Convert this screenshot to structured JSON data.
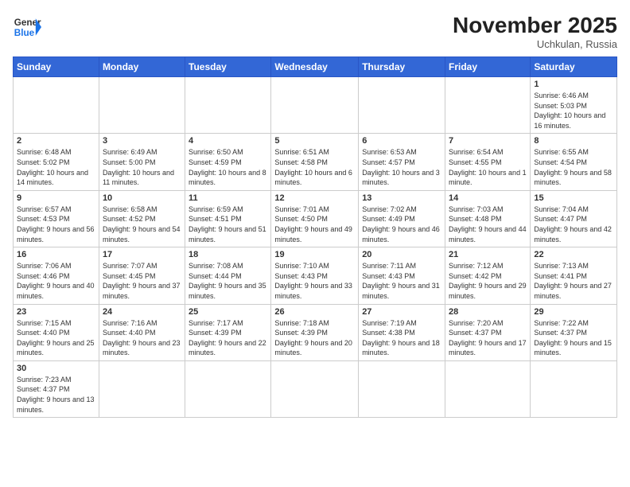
{
  "header": {
    "logo_general": "General",
    "logo_blue": "Blue",
    "month": "November 2025",
    "location": "Uchkulan, Russia"
  },
  "days": [
    "Sunday",
    "Monday",
    "Tuesday",
    "Wednesday",
    "Thursday",
    "Friday",
    "Saturday"
  ],
  "weeks": [
    [
      {
        "date": "",
        "info": ""
      },
      {
        "date": "",
        "info": ""
      },
      {
        "date": "",
        "info": ""
      },
      {
        "date": "",
        "info": ""
      },
      {
        "date": "",
        "info": ""
      },
      {
        "date": "",
        "info": ""
      },
      {
        "date": "1",
        "info": "Sunrise: 6:46 AM\nSunset: 5:03 PM\nDaylight: 10 hours and 16 minutes."
      }
    ],
    [
      {
        "date": "2",
        "info": "Sunrise: 6:48 AM\nSunset: 5:02 PM\nDaylight: 10 hours and 14 minutes."
      },
      {
        "date": "3",
        "info": "Sunrise: 6:49 AM\nSunset: 5:00 PM\nDaylight: 10 hours and 11 minutes."
      },
      {
        "date": "4",
        "info": "Sunrise: 6:50 AM\nSunset: 4:59 PM\nDaylight: 10 hours and 8 minutes."
      },
      {
        "date": "5",
        "info": "Sunrise: 6:51 AM\nSunset: 4:58 PM\nDaylight: 10 hours and 6 minutes."
      },
      {
        "date": "6",
        "info": "Sunrise: 6:53 AM\nSunset: 4:57 PM\nDaylight: 10 hours and 3 minutes."
      },
      {
        "date": "7",
        "info": "Sunrise: 6:54 AM\nSunset: 4:55 PM\nDaylight: 10 hours and 1 minute."
      },
      {
        "date": "8",
        "info": "Sunrise: 6:55 AM\nSunset: 4:54 PM\nDaylight: 9 hours and 58 minutes."
      }
    ],
    [
      {
        "date": "9",
        "info": "Sunrise: 6:57 AM\nSunset: 4:53 PM\nDaylight: 9 hours and 56 minutes."
      },
      {
        "date": "10",
        "info": "Sunrise: 6:58 AM\nSunset: 4:52 PM\nDaylight: 9 hours and 54 minutes."
      },
      {
        "date": "11",
        "info": "Sunrise: 6:59 AM\nSunset: 4:51 PM\nDaylight: 9 hours and 51 minutes."
      },
      {
        "date": "12",
        "info": "Sunrise: 7:01 AM\nSunset: 4:50 PM\nDaylight: 9 hours and 49 minutes."
      },
      {
        "date": "13",
        "info": "Sunrise: 7:02 AM\nSunset: 4:49 PM\nDaylight: 9 hours and 46 minutes."
      },
      {
        "date": "14",
        "info": "Sunrise: 7:03 AM\nSunset: 4:48 PM\nDaylight: 9 hours and 44 minutes."
      },
      {
        "date": "15",
        "info": "Sunrise: 7:04 AM\nSunset: 4:47 PM\nDaylight: 9 hours and 42 minutes."
      }
    ],
    [
      {
        "date": "16",
        "info": "Sunrise: 7:06 AM\nSunset: 4:46 PM\nDaylight: 9 hours and 40 minutes."
      },
      {
        "date": "17",
        "info": "Sunrise: 7:07 AM\nSunset: 4:45 PM\nDaylight: 9 hours and 37 minutes."
      },
      {
        "date": "18",
        "info": "Sunrise: 7:08 AM\nSunset: 4:44 PM\nDaylight: 9 hours and 35 minutes."
      },
      {
        "date": "19",
        "info": "Sunrise: 7:10 AM\nSunset: 4:43 PM\nDaylight: 9 hours and 33 minutes."
      },
      {
        "date": "20",
        "info": "Sunrise: 7:11 AM\nSunset: 4:43 PM\nDaylight: 9 hours and 31 minutes."
      },
      {
        "date": "21",
        "info": "Sunrise: 7:12 AM\nSunset: 4:42 PM\nDaylight: 9 hours and 29 minutes."
      },
      {
        "date": "22",
        "info": "Sunrise: 7:13 AM\nSunset: 4:41 PM\nDaylight: 9 hours and 27 minutes."
      }
    ],
    [
      {
        "date": "23",
        "info": "Sunrise: 7:15 AM\nSunset: 4:40 PM\nDaylight: 9 hours and 25 minutes."
      },
      {
        "date": "24",
        "info": "Sunrise: 7:16 AM\nSunset: 4:40 PM\nDaylight: 9 hours and 23 minutes."
      },
      {
        "date": "25",
        "info": "Sunrise: 7:17 AM\nSunset: 4:39 PM\nDaylight: 9 hours and 22 minutes."
      },
      {
        "date": "26",
        "info": "Sunrise: 7:18 AM\nSunset: 4:39 PM\nDaylight: 9 hours and 20 minutes."
      },
      {
        "date": "27",
        "info": "Sunrise: 7:19 AM\nSunset: 4:38 PM\nDaylight: 9 hours and 18 minutes."
      },
      {
        "date": "28",
        "info": "Sunrise: 7:20 AM\nSunset: 4:37 PM\nDaylight: 9 hours and 17 minutes."
      },
      {
        "date": "29",
        "info": "Sunrise: 7:22 AM\nSunset: 4:37 PM\nDaylight: 9 hours and 15 minutes."
      }
    ],
    [
      {
        "date": "30",
        "info": "Sunrise: 7:23 AM\nSunset: 4:37 PM\nDaylight: 9 hours and 13 minutes."
      },
      {
        "date": "",
        "info": ""
      },
      {
        "date": "",
        "info": ""
      },
      {
        "date": "",
        "info": ""
      },
      {
        "date": "",
        "info": ""
      },
      {
        "date": "",
        "info": ""
      },
      {
        "date": "",
        "info": ""
      }
    ]
  ]
}
